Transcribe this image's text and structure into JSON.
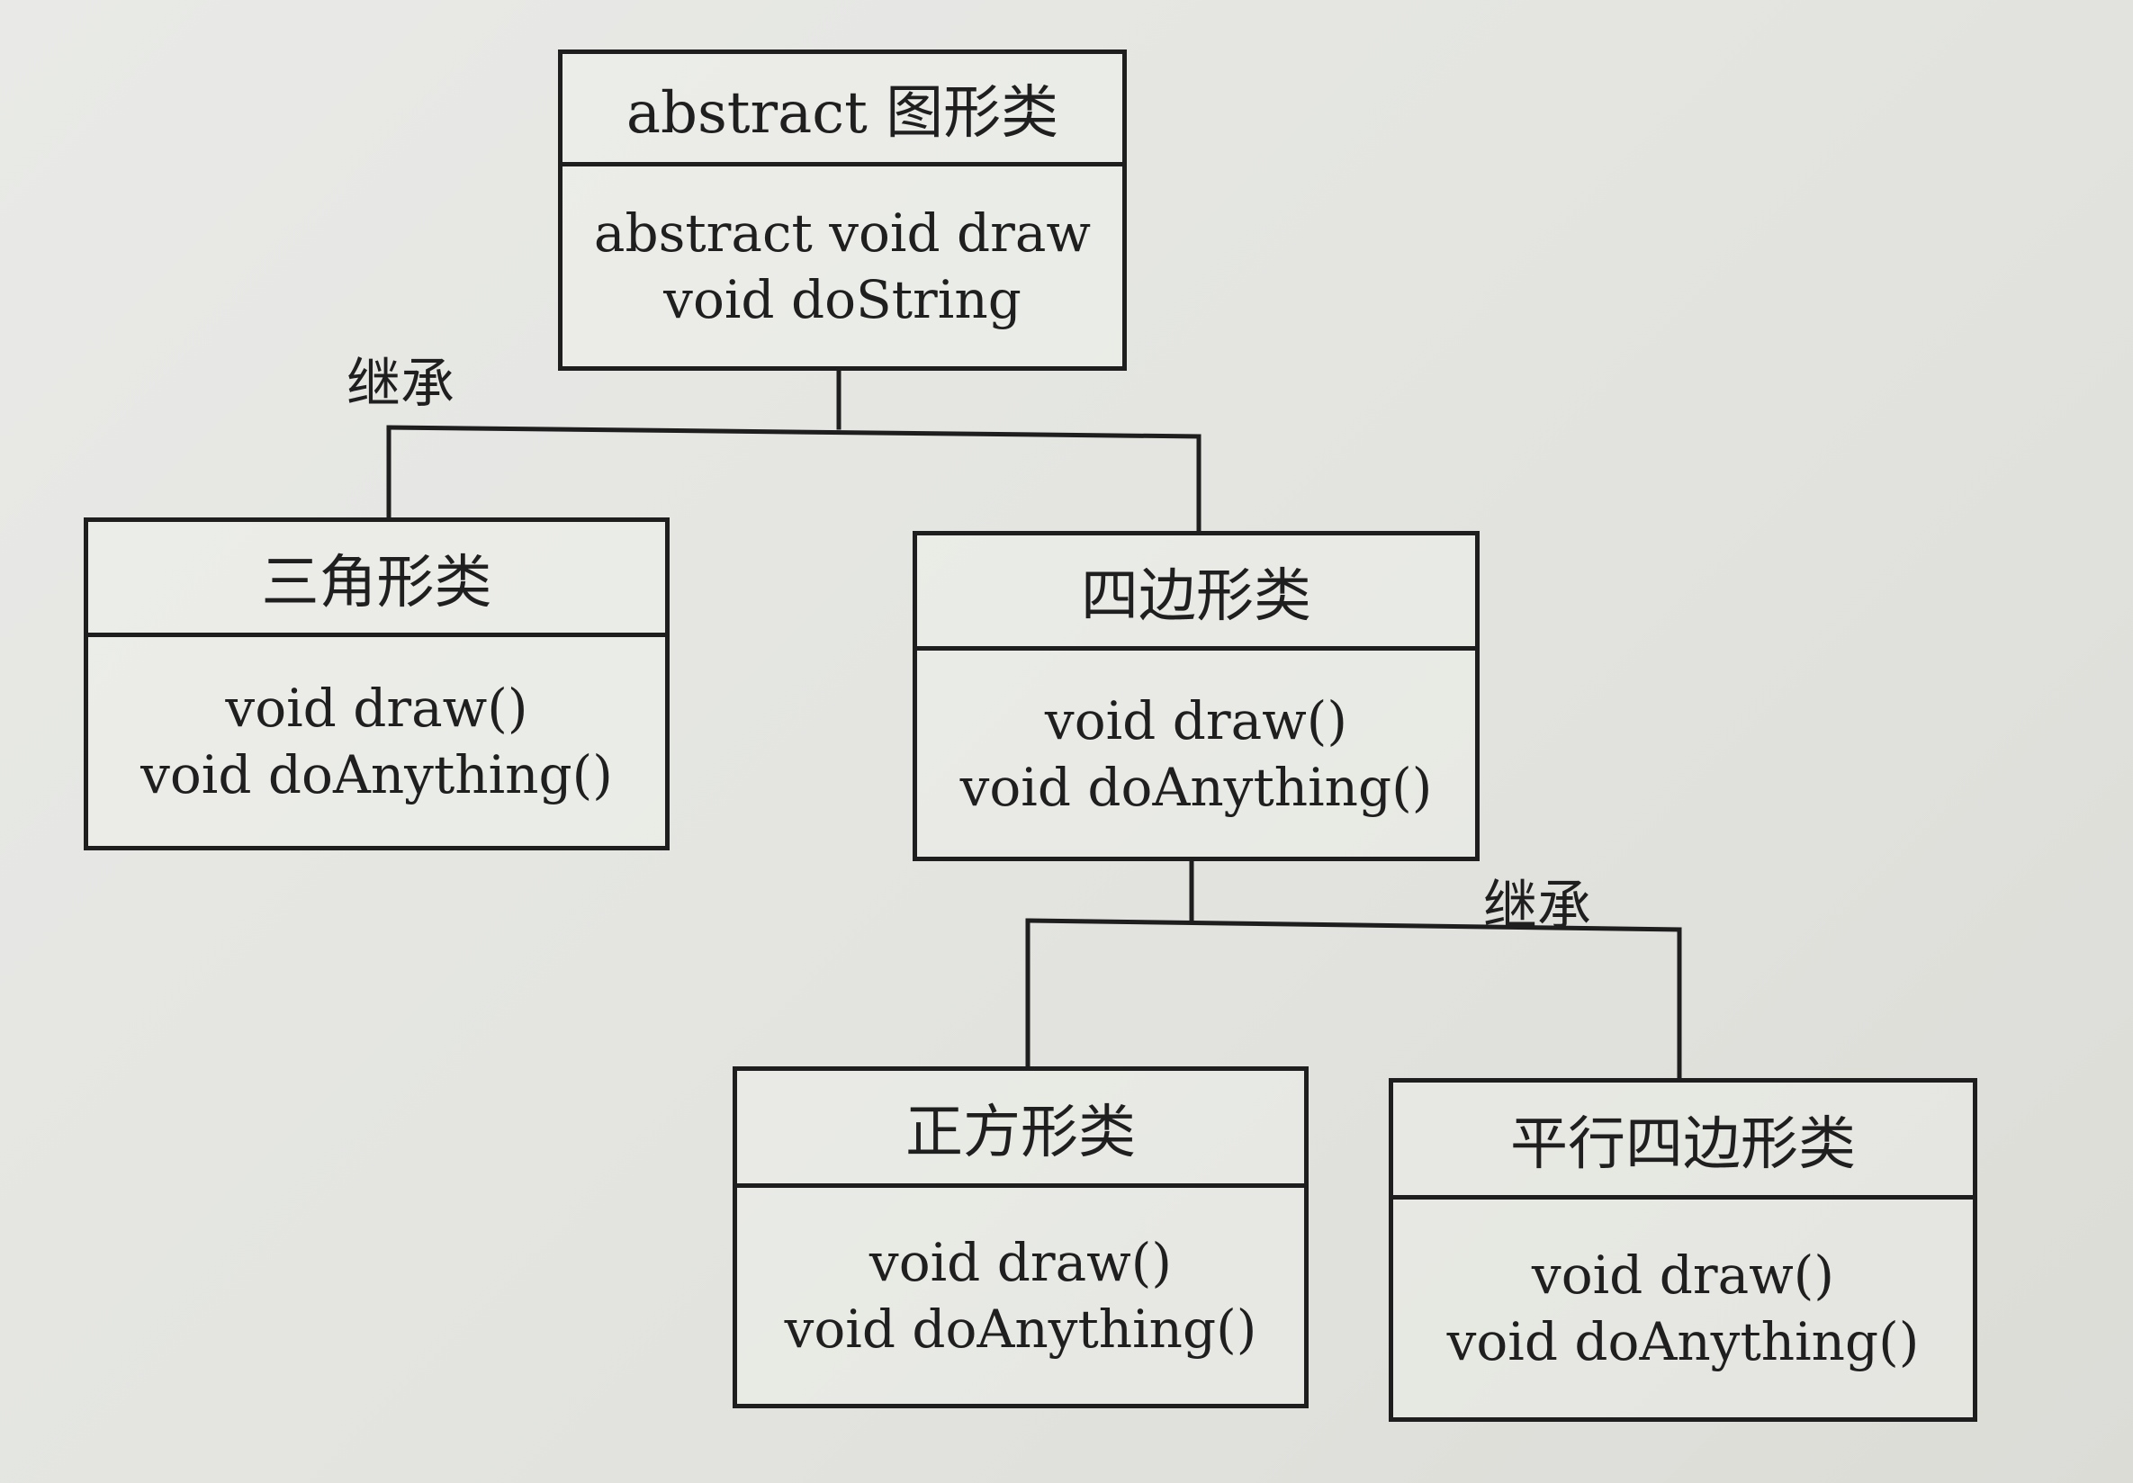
{
  "diagram": {
    "type": "uml-class-inheritance",
    "classes": {
      "shape": {
        "name": "abstract 图形类",
        "methods": [
          "abstract void draw",
          "void doString"
        ]
      },
      "triangle": {
        "name": "三角形类",
        "methods": [
          "void draw()",
          "void doAnything()"
        ]
      },
      "quadrilateral": {
        "name": "四边形类",
        "methods": [
          "void draw()",
          "void doAnything()"
        ]
      },
      "square": {
        "name": "正方形类",
        "methods": [
          "void draw()",
          "void doAnything()"
        ]
      },
      "parallelogram": {
        "name": "平行四边形类",
        "methods": [
          "void draw()",
          "void doAnything()"
        ]
      }
    },
    "relations": [
      {
        "label": "继承",
        "parent": "abstract 图形类",
        "children": [
          "三角形类",
          "四边形类"
        ]
      },
      {
        "label": "继承",
        "parent": "四边形类",
        "children": [
          "正方形类",
          "平行四边形类"
        ]
      }
    ]
  }
}
